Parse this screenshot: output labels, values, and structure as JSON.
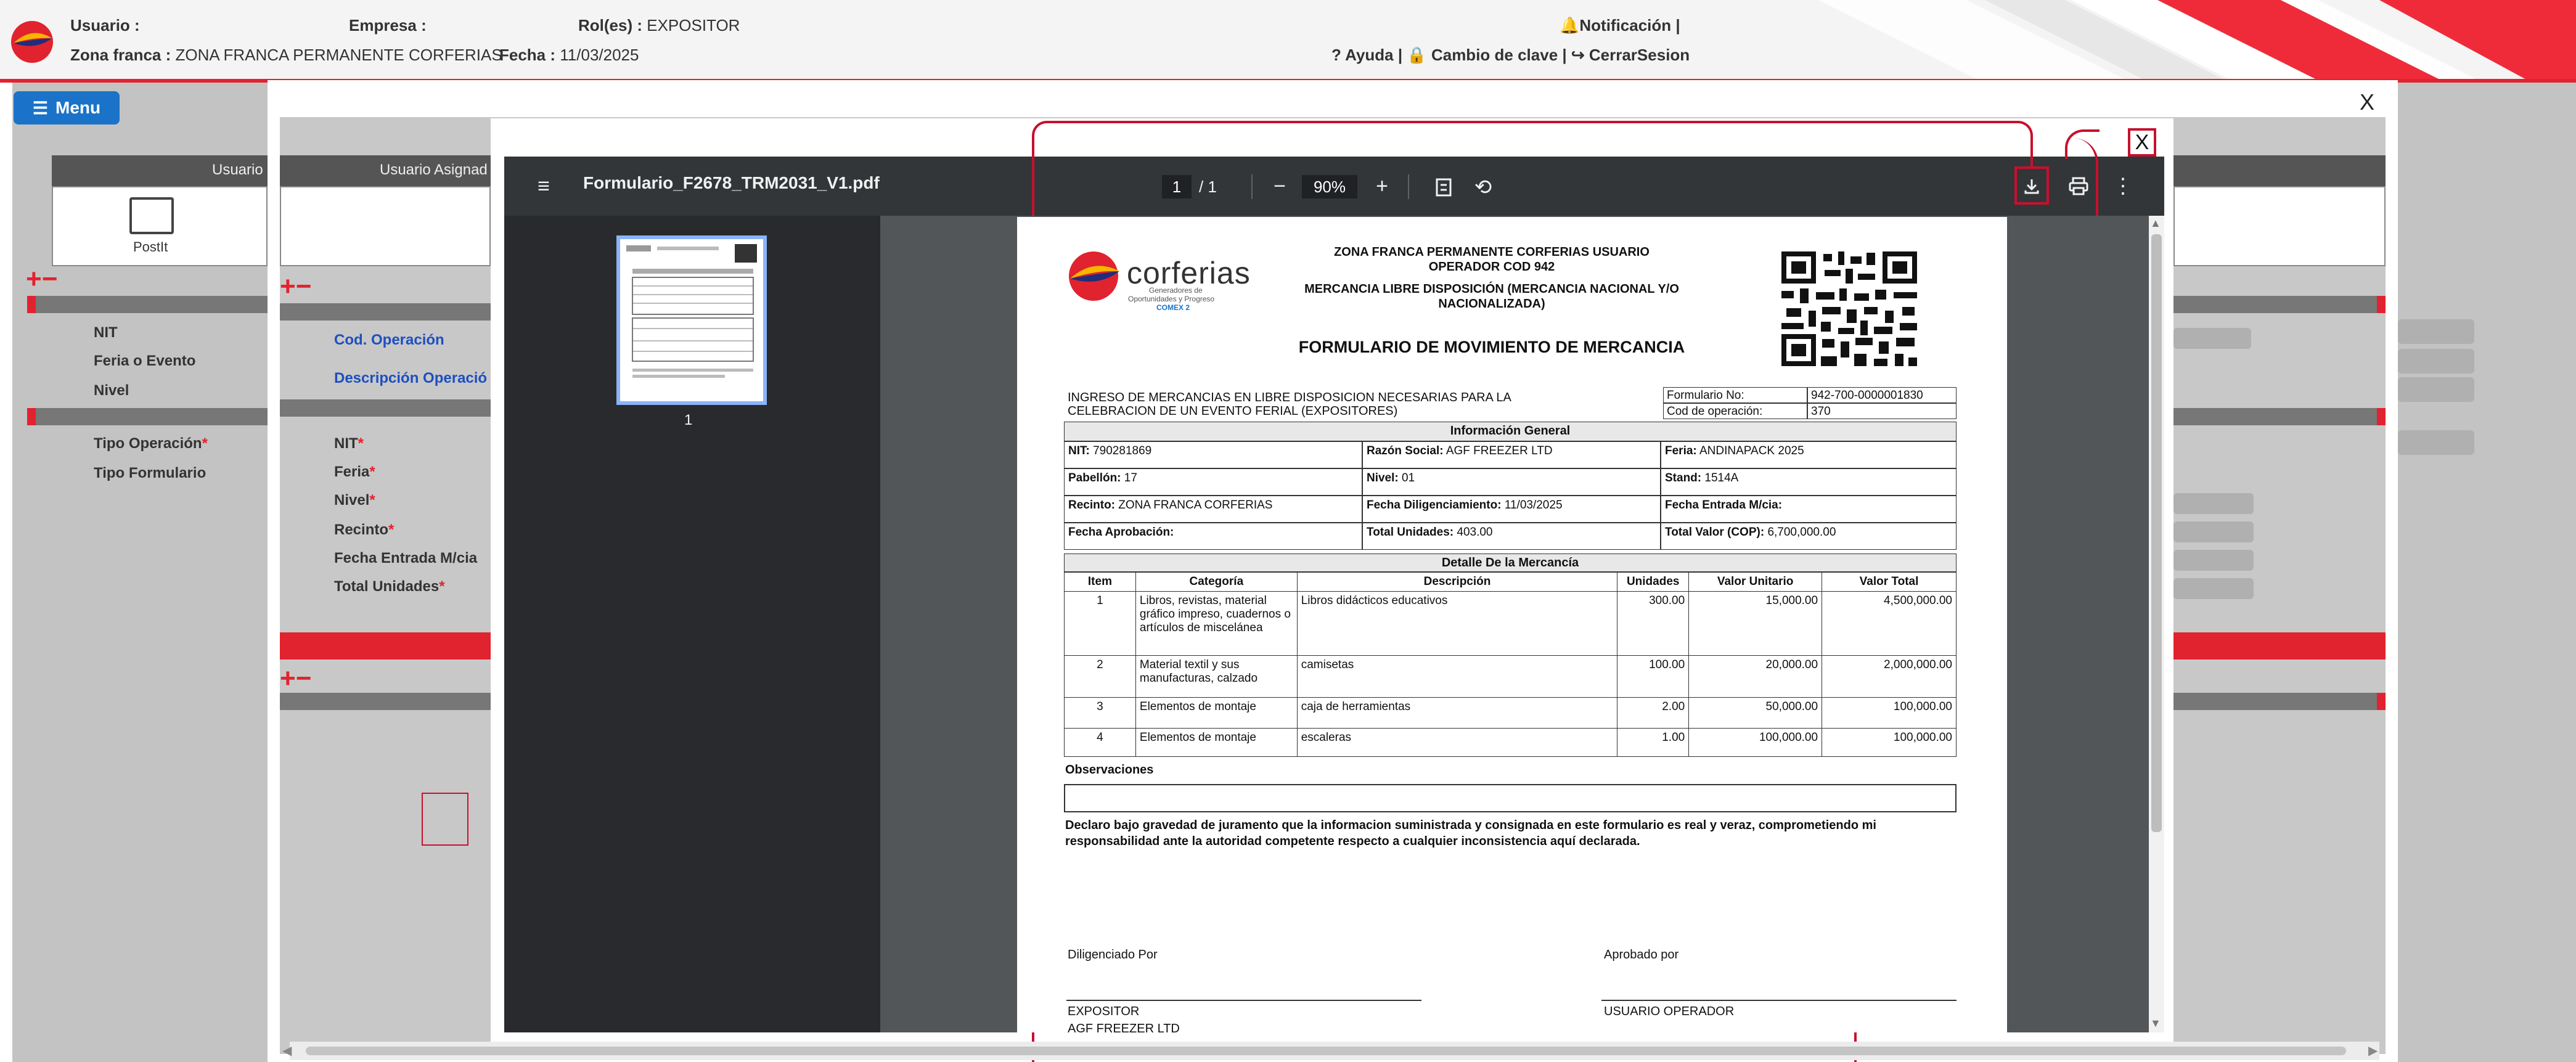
{
  "header": {
    "usuario_label": "Usuario :",
    "empresa_label": "Empresa :",
    "roles_label": "Rol(es) :",
    "roles_value": "EXPOSITOR",
    "zona_label": "Zona franca :",
    "zona_value": "ZONA FRANCA PERMANENTE CORFERIAS",
    "fecha_label": "Fecha :",
    "fecha_value": "11/03/2025",
    "notificacion": "Notificación |",
    "links": "? Ayuda | 🔒 Cambio de clave | ↪ CerrarSesion"
  },
  "menu_button": "Menu",
  "background": {
    "col_usuario": "Usuario",
    "col_usuario_asignado": "Usuario Asignad",
    "postit": "PostIt",
    "plus_minus": "+−",
    "left_labels": [
      "NIT",
      "Feria o Evento",
      "Nivel"
    ],
    "left_labels2": [
      "Tipo Operación",
      "Tipo Formulario"
    ],
    "cod_operacion": "Cod. Operación",
    "desc_operacion": "Descripción Operació",
    "form_labels": [
      "NIT",
      "Feria",
      "Nivel",
      "Recinto",
      "Fecha Entrada M/cia",
      "Total Unidades"
    ]
  },
  "modal": {
    "close": "X"
  },
  "viewer": {
    "filename": "Formulario_F2678_TRM2031_V1.pdf",
    "current_page": "1",
    "total_pages": "/  1",
    "zoom": "90%",
    "thumb_page": "1",
    "close": "X"
  },
  "doc": {
    "logo_text": "corferias",
    "logo_sub1": "Generadores de",
    "logo_sub2": "Oportunidades y Progreso",
    "logo_sub3": "COMEX 2",
    "head1": "ZONA FRANCA PERMANENTE CORFERIAS USUARIO",
    "head2": "OPERADOR COD 942",
    "head3": "MERCANCIA LIBRE DISPOSICIÓN (MERCANCIA NACIONAL Y/O",
    "head4": "NACIONALIZADA)",
    "title": "FORMULARIO DE MOVIMIENTO DE MERCANCIA",
    "ingreso1": "INGRESO DE MERCANCIAS EN LIBRE DISPOSICION NECESARIAS PARA LA",
    "ingreso2": "CELEBRACION DE UN EVENTO FERIAL (EXPOSITORES)",
    "formulario_label": "Formulario No:",
    "formulario_value": "942-700-0000001830",
    "codop_label": "Cod de operación:",
    "codop_value": "370",
    "info_general": "Información General",
    "nit_label": "NIT:",
    "nit_value": "790281869",
    "razon_label": "Razón Social:",
    "razon_value": "AGF FREEZER LTD",
    "feria_label": "Feria:",
    "feria_value": "ANDINAPACK 2025",
    "pabellon_label": "Pabellón:",
    "pabellon_value": "17",
    "nivel_label": "Nivel:",
    "nivel_value": "01",
    "stand_label": "Stand:",
    "stand_value": "1514A",
    "recinto_label": "Recinto:",
    "recinto_value": "ZONA FRANCA CORFERIAS",
    "fecha_dil_label": "Fecha Diligenciamiento:",
    "fecha_dil_value": "11/03/2025",
    "fecha_entrada_label": "Fecha Entrada M/cia:",
    "fecha_aprob_label": "Fecha Aprobación:",
    "total_unid_label": "Total Unidades:",
    "total_unid_value": "403.00",
    "total_valor_label": "Total Valor (COP):",
    "total_valor_value": "6,700,000.00",
    "detalle": "Detalle De la Mercancía",
    "columns": [
      "Item",
      "Categoría",
      "Descripción",
      "Unidades",
      "Valor Unitario",
      "Valor Total"
    ],
    "items": [
      {
        "item": "1",
        "categoria": "Libros, revistas, material gráfico impreso, cuadernos o artículos de miscelánea",
        "descripcion": "Libros didácticos educativos",
        "unidades": "300.00",
        "unitario": "15,000.00",
        "total": "4,500,000.00"
      },
      {
        "item": "2",
        "categoria": "Material textil y sus manufacturas, calzado",
        "descripcion": "camisetas",
        "unidades": "100.00",
        "unitario": "20,000.00",
        "total": "2,000,000.00"
      },
      {
        "item": "3",
        "categoria": "Elementos de montaje",
        "descripcion": "caja de herramientas",
        "unidades": "2.00",
        "unitario": "50,000.00",
        "total": "100,000.00"
      },
      {
        "item": "4",
        "categoria": "Elementos de montaje",
        "descripcion": "escaleras",
        "unidades": "1.00",
        "unitario": "100,000.00",
        "total": "100,000.00"
      }
    ],
    "observaciones": "Observaciones",
    "declaro1": "Declaro bajo gravedad de juramento que la informacion suministrada y consignada en este formulario es real y veraz, comprometiendo mi",
    "declaro2": "responsabilidad ante la autoridad competente respecto a cualquier inconsistencia aquí declarada.",
    "diligenciado": "Diligenciado Por",
    "aprobado": "Aprobado por",
    "expositor": "EXPOSITOR",
    "usuario_operador": "USUARIO OPERADOR",
    "agf": "AGF FREEZER LTD"
  },
  "colors": {
    "brand_red": "#e0232e",
    "annotation_red": "#c8102e",
    "menu_blue": "#1a73c8",
    "toolbar": "#323639"
  }
}
